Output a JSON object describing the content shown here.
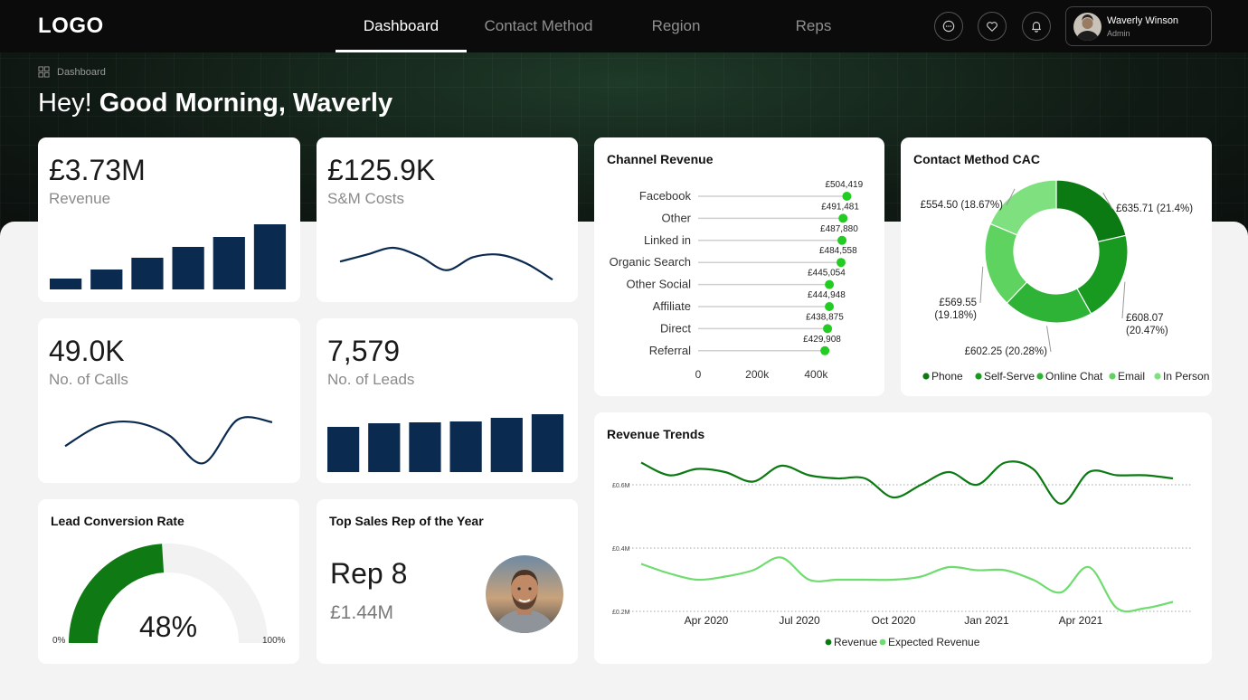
{
  "nav": {
    "logo": "LOGO",
    "tabs": [
      {
        "label": "Dashboard",
        "active": true
      },
      {
        "label": "Contact Method",
        "active": false
      },
      {
        "label": "Region",
        "active": false
      },
      {
        "label": "Reps",
        "active": false
      }
    ],
    "icons": [
      "chat-icon",
      "heart-icon",
      "bell-icon"
    ],
    "user": {
      "name": "Waverly Winson",
      "role": "Admin"
    }
  },
  "breadcrumb": "Dashboard",
  "greeting": {
    "prefix": "Hey!",
    "main": "Good Morning, Waverly"
  },
  "colors": {
    "navy": "#0b2a4f",
    "green_dark": "#0f7a14",
    "green_mid": "#22a329",
    "green_light": "#6edc6e",
    "dot": "#22cc22"
  },
  "kpis": {
    "revenue": {
      "value": "£3.73M",
      "label": "Revenue"
    },
    "sm_costs": {
      "value": "£125.9K",
      "label": "S&M Costs"
    },
    "calls": {
      "value": "49.0K",
      "label": "No. of Calls"
    },
    "leads": {
      "value": "7,579",
      "label": "No. of Leads"
    }
  },
  "lead_conversion": {
    "title": "Lead Conversion Rate",
    "value_label": "48%",
    "value": 48,
    "min_label": "0%",
    "max_label": "100%"
  },
  "top_rep": {
    "title": "Top Sales Rep of the Year",
    "name": "Rep 8",
    "amount": "£1.44M"
  },
  "chart_data": [
    {
      "id": "revenue-mini",
      "type": "bar",
      "values": [
        12,
        22,
        35,
        47,
        58,
        72
      ]
    },
    {
      "id": "sm-costs-mini",
      "type": "line",
      "values": [
        26,
        34,
        42,
        32,
        16,
        31,
        34,
        24,
        5
      ]
    },
    {
      "id": "calls-mini",
      "type": "line",
      "values": [
        24,
        48,
        52,
        37,
        4,
        55,
        52
      ]
    },
    {
      "id": "leads-mini",
      "type": "bar",
      "values": [
        50,
        54,
        55,
        56,
        60,
        64
      ]
    },
    {
      "id": "channel-revenue",
      "type": "scatter",
      "title": "Channel Revenue",
      "categories": [
        "Facebook",
        "Other",
        "Linked in",
        "Organic Search",
        "Other Social",
        "Affiliate",
        "Direct",
        "Referral"
      ],
      "values": [
        504419,
        491481,
        487880,
        484558,
        445054,
        444948,
        438875,
        429908
      ],
      "value_labels": [
        "£504,419",
        "£491,481",
        "£487,880",
        "£484,558",
        "£445,054",
        "£444,948",
        "£438,875",
        "£429,908"
      ],
      "x_ticks": [
        {
          "v": 0,
          "label": "0"
        },
        {
          "v": 200000,
          "label": "200k"
        },
        {
          "v": 400000,
          "label": "400k"
        }
      ],
      "xlim": [
        0,
        500000
      ]
    },
    {
      "id": "contact-method-cac",
      "type": "pie",
      "title": "Contact Method CAC",
      "categories": [
        "Phone",
        "Self-Serve",
        "Online Chat",
        "Email",
        "In Person"
      ],
      "values": [
        635.71,
        608.07,
        602.25,
        569.55,
        554.5
      ],
      "percents": [
        21.4,
        20.47,
        20.28,
        19.18,
        18.67
      ],
      "slice_labels": [
        "£635.71 (21.4%)",
        "£608.07\n(20.47%)",
        "£602.25 (20.28%)",
        "£569.55\n(19.18%)",
        "£554.50 (18.67%)"
      ],
      "colors": [
        "#0b7a12",
        "#18991f",
        "#2fb336",
        "#5fd35f",
        "#7fe07f"
      ],
      "legend": "bottom"
    },
    {
      "id": "revenue-trends",
      "type": "line",
      "title": "Revenue Trends",
      "x_ticks": [
        "Apr 2020",
        "Jul 2020",
        "Oct 2020",
        "Jan 2021",
        "Apr 2021"
      ],
      "y_ticks": [
        {
          "v": 0.2,
          "label": "£0.2M"
        },
        {
          "v": 0.4,
          "label": "£0.4M"
        },
        {
          "v": 0.6,
          "label": "£0.6M"
        }
      ],
      "ylim": [
        0.2,
        0.68
      ],
      "series": [
        {
          "name": "Revenue",
          "color": "#0b7a12",
          "values": [
            0.67,
            0.63,
            0.65,
            0.64,
            0.61,
            0.66,
            0.63,
            0.62,
            0.62,
            0.56,
            0.6,
            0.64,
            0.6,
            0.67,
            0.65,
            0.54,
            0.64,
            0.63,
            0.63,
            0.62
          ]
        },
        {
          "name": "Expected Revenue",
          "color": "#6edc6e",
          "values": [
            0.35,
            0.32,
            0.3,
            0.31,
            0.33,
            0.37,
            0.3,
            0.3,
            0.3,
            0.3,
            0.31,
            0.34,
            0.33,
            0.33,
            0.3,
            0.26,
            0.34,
            0.21,
            0.21,
            0.23
          ]
        }
      ],
      "legend": "bottom"
    }
  ]
}
